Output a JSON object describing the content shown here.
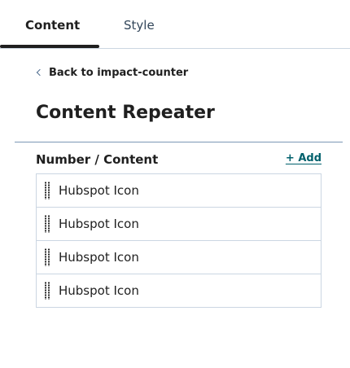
{
  "tabs": [
    {
      "label": "Content",
      "active": true
    },
    {
      "label": "Style",
      "active": false
    }
  ],
  "back_link": {
    "label": "Back to impact-counter",
    "icon": "chevron-left-icon"
  },
  "page_title": "Content Repeater",
  "section": {
    "label": "Number / Content",
    "add_label": "+ Add",
    "items": [
      {
        "label": "Hubspot Icon",
        "icon": "drag-handle-icon"
      },
      {
        "label": "Hubspot Icon",
        "icon": "drag-handle-icon"
      },
      {
        "label": "Hubspot Icon",
        "icon": "drag-handle-icon"
      },
      {
        "label": "Hubspot Icon",
        "icon": "drag-handle-icon"
      }
    ]
  },
  "colors": {
    "accent_link": "#00606c",
    "text": "#1f1f1f",
    "border": "#cbd6e2"
  }
}
